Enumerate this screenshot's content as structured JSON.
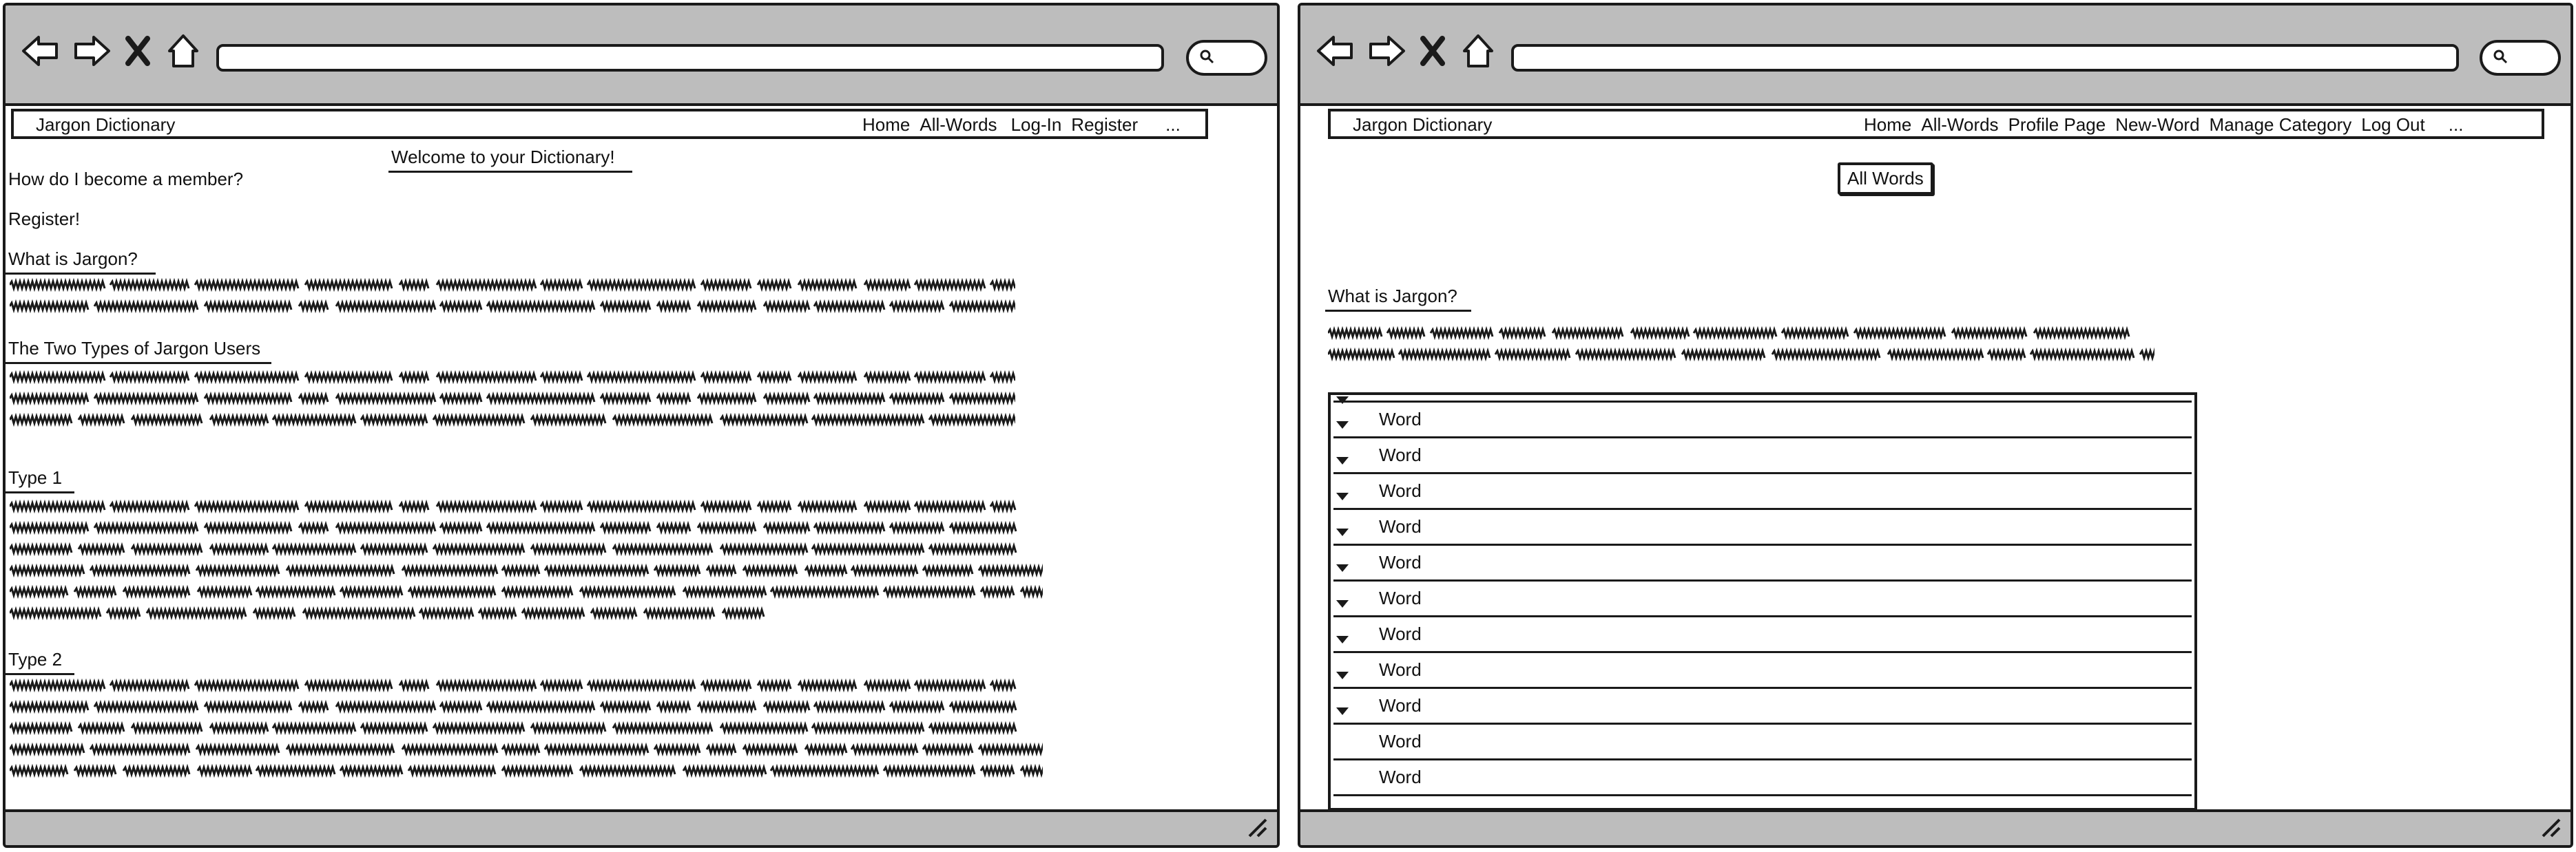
{
  "left": {
    "app_name": "Jargon Dictionary",
    "nav": [
      "Home",
      "All-Words",
      "Log-In",
      "Register",
      "..."
    ],
    "welcome": "Welcome to your Dictionary!",
    "q_member": "How do I become  a member?",
    "register": "Register!",
    "h_what": "What is Jargon?",
    "h_types": "The Two Types of Jargon Users",
    "h_type1": "Type 1",
    "h_type2": "Type 2"
  },
  "right": {
    "app_name": "Jargon Dictionary",
    "nav": [
      "Home",
      "All-Words",
      "Profile Page",
      "New-Word",
      "Manage Category",
      "Log Out",
      "..."
    ],
    "all_words_button": "All Words",
    "h_what": "What is Jargon?",
    "words": [
      {
        "label": "",
        "expandable": true
      },
      {
        "label": "Word",
        "expandable": true
      },
      {
        "label": "Word",
        "expandable": true
      },
      {
        "label": "Word",
        "expandable": true
      },
      {
        "label": "Word",
        "expandable": true
      },
      {
        "label": "Word",
        "expandable": true
      },
      {
        "label": "Word",
        "expandable": true
      },
      {
        "label": "Word",
        "expandable": true
      },
      {
        "label": "Word",
        "expandable": true
      },
      {
        "label": "Word",
        "expandable": true
      },
      {
        "label": "Word",
        "expandable": false
      },
      {
        "label": "Word",
        "expandable": false
      }
    ]
  },
  "icons": [
    "back-arrow-icon",
    "forward-arrow-icon",
    "close-icon",
    "home-icon",
    "search-icon",
    "resize-grip-icon"
  ],
  "colors": {
    "chrome": "#bdbdbd",
    "ink": "#1a1a1a",
    "background": "#ffffff"
  }
}
